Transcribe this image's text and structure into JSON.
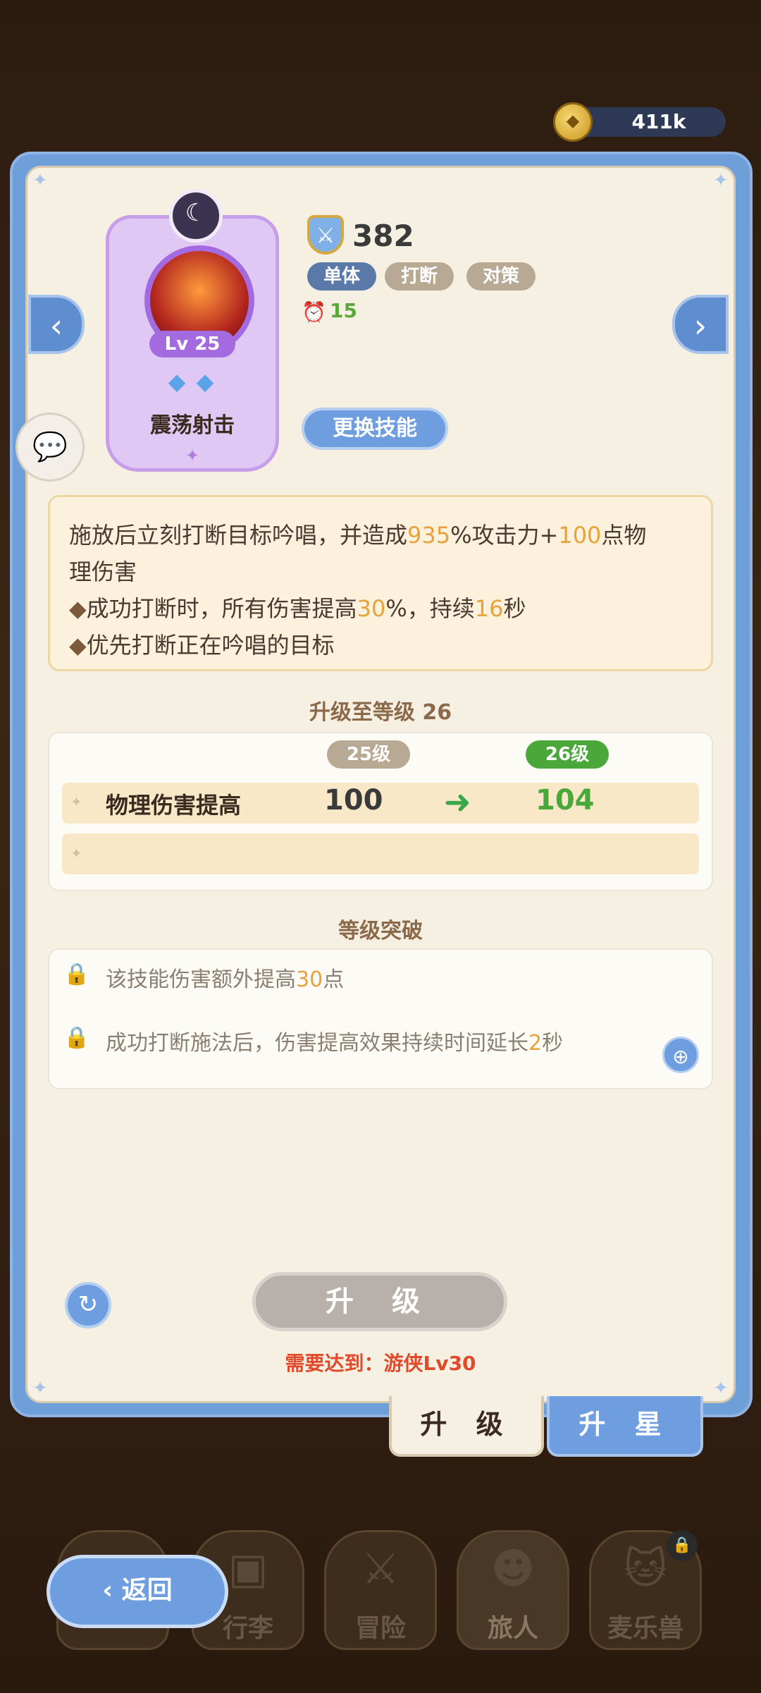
{
  "currency": {
    "value": "411k"
  },
  "skill": {
    "level": "Lv 25",
    "name": "震荡射击",
    "power": "382",
    "tags": [
      "单体",
      "打断",
      "对策"
    ],
    "cooldown": "15",
    "change_label": "更换技能"
  },
  "description": {
    "line1": [
      "施放后立刻打断目标吟唱，并造成",
      "935",
      "%攻击力+",
      "100",
      "点物"
    ],
    "line2": "理伤害",
    "bullet": "◆",
    "line3": [
      "成功打断时，所有伤害提高",
      "30",
      "%，持续",
      "16",
      "秒"
    ],
    "line4": "优先打断正在吟唱的目标"
  },
  "upgrade": {
    "title": "升级至等级 26",
    "from_label": "25级",
    "to_label": "26级",
    "stat_label": "物理伤害提高",
    "from_value": "100",
    "to_value": "104"
  },
  "breakthrough": {
    "title": "等级突破",
    "item1": [
      "该技能伤害额外提高",
      "30",
      "点"
    ],
    "item2": [
      "成功打断施法后，伤害提高效果持续时间延长",
      "2",
      "秒"
    ]
  },
  "actions": {
    "upgrade_label": "升 级",
    "requirement": "需要达到：游侠Lv30"
  },
  "tabs": {
    "upgrade": "升 级",
    "star": "升 星"
  },
  "nav": {
    "back": "返回",
    "items": [
      "行李",
      "冒险",
      "旅人",
      "麦乐兽"
    ]
  },
  "colors": {
    "accent": "#6e9ee0",
    "highlight": "#e8a23a",
    "positive": "#4aa83a",
    "warning": "#e04a2a"
  }
}
